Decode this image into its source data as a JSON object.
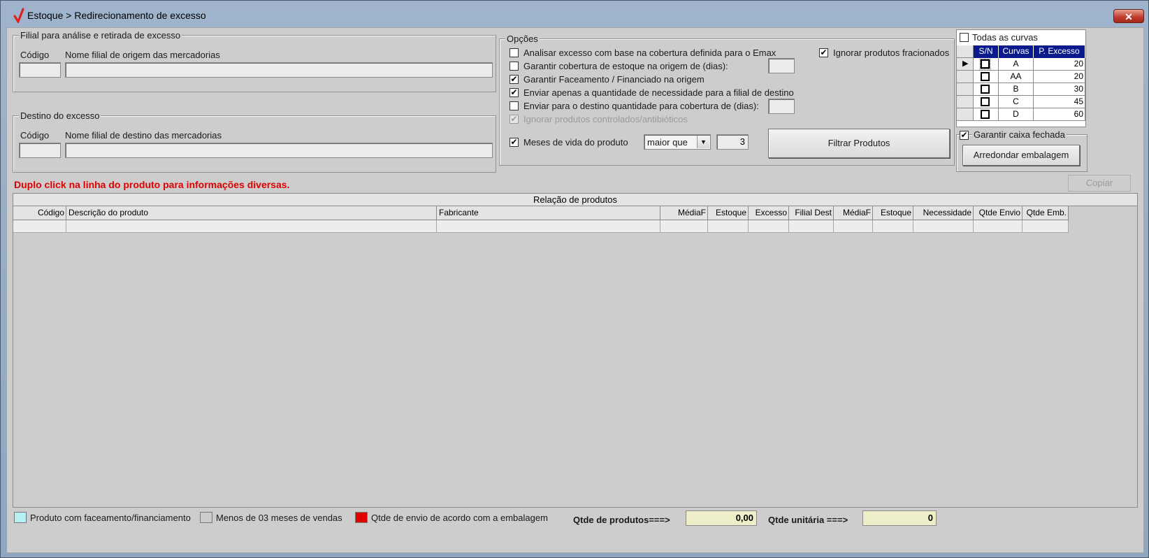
{
  "window": {
    "title": "Estoque > Redirecionamento de excesso",
    "close_label": "✕"
  },
  "origem": {
    "legend": "Filial para análise e retirada de excesso",
    "codigo_label": "Código",
    "nome_label": "Nome filial de origem das mercadorias",
    "codigo_value": "",
    "nome_value": ""
  },
  "destino": {
    "legend": "Destino do excesso",
    "codigo_label": "Código",
    "nome_label": "Nome filial de destino das mercadorias",
    "codigo_value": "",
    "nome_value": ""
  },
  "opcoes": {
    "legend": "Opções",
    "items": [
      {
        "label": "Analisar excesso com base na cobertura definida para o Emax",
        "checked": false,
        "enabled": true
      },
      {
        "label": "Garantir cobertura de estoque na origem de (dias):",
        "checked": false,
        "enabled": true
      },
      {
        "label": "Garantir Faceamento / Financiado na origem",
        "checked": true,
        "enabled": true
      },
      {
        "label": "Enviar apenas a quantidade de necessidade para a filial de destino",
        "checked": true,
        "enabled": true
      },
      {
        "label": "Enviar para o destino quantidade para cobertura de (dias):",
        "checked": false,
        "enabled": true
      },
      {
        "label": "Ignorar produtos controlados/antibióticos",
        "checked": true,
        "enabled": false
      }
    ],
    "ignorar_fracionados": {
      "label": "Ignorar produtos fracionados",
      "checked": true
    },
    "meses_vida": {
      "label": "Meses de vida do produto",
      "checked": true,
      "operator": "maior que",
      "value": "3"
    },
    "filtrar_label": "Filtrar Produtos"
  },
  "curvas": {
    "todas_label": "Todas as curvas",
    "todas_checked": false,
    "headers": [
      "S/N",
      "Curvas",
      "P. Excesso"
    ],
    "rows": [
      {
        "curva": "A",
        "excesso": "20",
        "checked": false
      },
      {
        "curva": "AA",
        "excesso": "20",
        "checked": false
      },
      {
        "curva": "B",
        "excesso": "30",
        "checked": false
      },
      {
        "curva": "C",
        "excesso": "45",
        "checked": false
      },
      {
        "curva": "D",
        "excesso": "60",
        "checked": false
      }
    ]
  },
  "caixa": {
    "label": "Garantir caixa fechada",
    "checked": true,
    "arredondar_label": "Arredondar embalagem"
  },
  "hint": "Duplo click na linha do produto para informações diversas.",
  "copiar_label": "Copiar",
  "grid": {
    "caption": "Relação de produtos",
    "columns": [
      "Código",
      "Descrição do produto",
      "Fabricante",
      "MédiaF",
      "Estoque",
      "Excesso",
      "Filial Dest",
      "MédiaF",
      "Estoque",
      "Necessidade",
      "Qtde Envio",
      "Qtde Emb."
    ]
  },
  "legend": {
    "items": [
      {
        "label": "Produto com faceamento/financiamento",
        "color": "#b8f0f0"
      },
      {
        "label": "Menos de 03 meses de vendas",
        "color": "#cdcdcd"
      },
      {
        "label": "Qtde de envio de acordo com a embalagem",
        "color": "#e00000"
      }
    ]
  },
  "totais": {
    "produtos_label": "Qtde de produtos===>",
    "produtos_value": "0,00",
    "unitaria_label": "Qtde unitária ===>",
    "unitaria_value": "0"
  },
  "colors": {
    "hint": "#e00000",
    "selection": "#0a1a8c"
  }
}
